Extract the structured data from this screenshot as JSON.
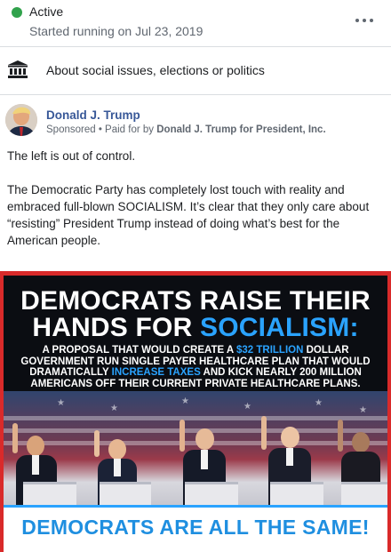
{
  "status": {
    "label": "Active",
    "started": "Started running on Jul 23, 2019",
    "color": "#31a24c"
  },
  "category": {
    "icon": "building-columns-icon",
    "label": "About social issues, elections or politics"
  },
  "advertiser": {
    "name": "Donald J. Trump",
    "sponsored": "Sponsored",
    "paid_prefix": "• Paid for by",
    "paid_by": "Donald J. Trump for President, Inc."
  },
  "post": {
    "paragraph_1": "The left is out of control.",
    "paragraph_2": "The Democratic Party has completely lost touch with reality and embraced full-blown SOCIALISM. It’s clear that they only care about “resisting” President Trump instead of doing what’s best for the American people."
  },
  "creative": {
    "headline_line_1": "DEMOCRATS RAISE THEIR",
    "headline_line_2_prefix": "HANDS FOR ",
    "headline_line_2_accent": "SOCIALISM:",
    "sub_part_1": "A PROPOSAL THAT WOULD CREATE A ",
    "sub_accent_1": "$32 TRILLION",
    "sub_part_2": " DOLLAR GOVERNMENT RUN SINGLE PAYER HEALTHCARE PLAN THAT WOULD DRAMATICALLY ",
    "sub_accent_2": "INCREASE TAXES",
    "sub_part_3": " AND KICK NEARLY 200 MILLION AMERICANS OFF THEIR CURRENT PRIVATE HEALTHCARE PLANS.",
    "footer": "DEMOCRATS ARE ALL THE SAME!",
    "accent_color": "#2aa3ff",
    "border_color": "#d92a2a"
  }
}
